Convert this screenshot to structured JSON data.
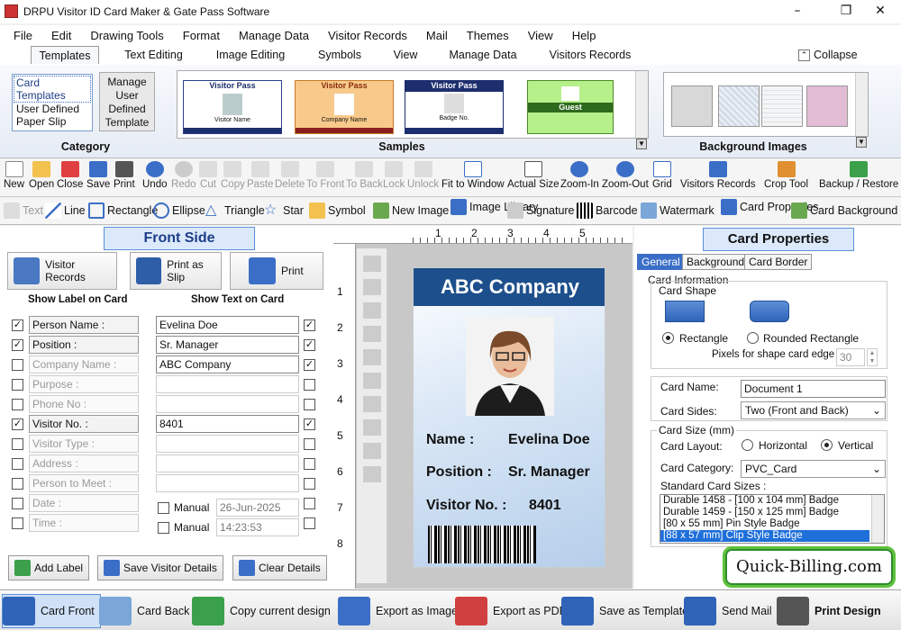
{
  "window": {
    "title": "DRPU Visitor ID Card Maker & Gate Pass Software"
  },
  "menu": [
    "File",
    "Edit",
    "Drawing Tools",
    "Format",
    "Manage Data",
    "Visitor Records",
    "Mail",
    "Themes",
    "View",
    "Help"
  ],
  "ribbon_tabs": [
    "Templates",
    "Text Editing",
    "Image Editing",
    "Symbols",
    "View",
    "Manage Data",
    "Visitors Records"
  ],
  "collapse_label": "Collapse",
  "category": {
    "items": [
      "Card Templates",
      "User Defined",
      "Paper Slip"
    ],
    "manage_label": "Manage User Defined Template",
    "title": "Category"
  },
  "samples": {
    "title": "Samples",
    "items": [
      {
        "title": "Visitor Pass",
        "sub": "Visitor Name"
      },
      {
        "title": "Visitor Pass",
        "sub": "Company Name"
      },
      {
        "title": "Visitor Pass",
        "sub": "Badge No."
      },
      {
        "title": "Guest",
        "sub": ""
      }
    ]
  },
  "background": {
    "title": "Background Images"
  },
  "toolbar": [
    "New",
    "Open",
    "Close",
    "Save",
    "Print",
    "Undo",
    "Redo",
    "Cut",
    "Copy",
    "Paste",
    "Delete",
    "To Front",
    "To Back",
    "Lock",
    "Unlock",
    "Fit to Window",
    "Actual Size",
    "Zoom-In",
    "Zoom-Out",
    "Grid",
    "Visitors Records",
    "Crop Tool",
    "Backup / Restore"
  ],
  "drawbar": [
    "Text",
    "Line",
    "Rectangle",
    "Ellipse",
    "Triangle",
    "Star",
    "Symbol",
    "New Image",
    "Image Library",
    "Signature",
    "Barcode",
    "Watermark",
    "Card Properties",
    "Card Background"
  ],
  "left": {
    "title": "Front Side",
    "buttons": [
      "Visitor Records",
      "Print as Slip",
      "Print"
    ],
    "col_label": "Show Label on Card",
    "col_text": "Show Text on Card",
    "rows": [
      {
        "label": "Person Name :",
        "value": "Evelina Doe",
        "l": true,
        "r": true
      },
      {
        "label": "Position :",
        "value": "Sr. Manager",
        "l": true,
        "r": true
      },
      {
        "label": "Company Name :",
        "value": "ABC Company",
        "l": false,
        "r": true
      },
      {
        "label": "Purpose :",
        "value": "",
        "l": false,
        "r": false
      },
      {
        "label": "Phone No :",
        "value": "",
        "l": false,
        "r": false
      },
      {
        "label": "Visitor No. :",
        "value": "8401",
        "l": true,
        "r": true
      },
      {
        "label": "Visitor Type :",
        "value": "",
        "l": false,
        "r": false
      },
      {
        "label": "Address :",
        "value": "",
        "l": false,
        "r": false
      },
      {
        "label": "Person to Meet :",
        "value": "",
        "l": false,
        "r": false
      },
      {
        "label": "Date :",
        "value": "",
        "l": false,
        "r": false
      },
      {
        "label": "Time :",
        "value": "",
        "l": false,
        "r": false
      }
    ],
    "manual_label": "Manual",
    "date_value": "26-Jun-2025",
    "time_value": "14:23:53",
    "bottom": [
      "Add Label",
      "Save Visitor Details",
      "Clear Details"
    ]
  },
  "card": {
    "company": "ABC Company",
    "name_label": "Name :",
    "name": "Evelina Doe",
    "position_label": "Position :",
    "position": "Sr. Manager",
    "visitor_label": "Visitor No. :",
    "visitor": "8401"
  },
  "ruler": {
    "top": [
      "1",
      "2",
      "3",
      "4",
      "5"
    ],
    "left": [
      "1",
      "2",
      "3",
      "4",
      "5",
      "6",
      "7",
      "8"
    ]
  },
  "right": {
    "title": "Card Properties",
    "tabs": [
      "General",
      "Background",
      "Card Border"
    ],
    "info_label": "Card Information",
    "shape_label": "Card Shape",
    "shape_rect": "Rectangle",
    "shape_round": "Rounded Rectangle",
    "pixels_label": "Pixels for shape card edge :",
    "pixels_value": "30",
    "name_label": "Card Name:",
    "name_value": "Document 1",
    "sides_label": "Card Sides:",
    "sides_value": "Two (Front and Back)",
    "size_label": "Card Size (mm)",
    "layout_label": "Card Layout:",
    "layout_h": "Horizontal",
    "layout_v": "Vertical",
    "category_label": "Card Category:",
    "category_value": "PVC_Card",
    "std_label": "Standard Card Sizes :",
    "sizes": [
      "Durable 1458 - [100 x 104 mm] Badge",
      "Durable 1459 - [150 x 125 mm] Badge",
      "[80 x 55 mm] Pin Style Badge",
      "[88 x 57 mm] Clip Style Badge"
    ]
  },
  "footer": [
    "Card Front",
    "Card Back",
    "Copy current design",
    "Export as Image",
    "Export as PDF",
    "Save as Template",
    "Send Mail",
    "Print Design"
  ],
  "brand": "Quick-Billing.com"
}
